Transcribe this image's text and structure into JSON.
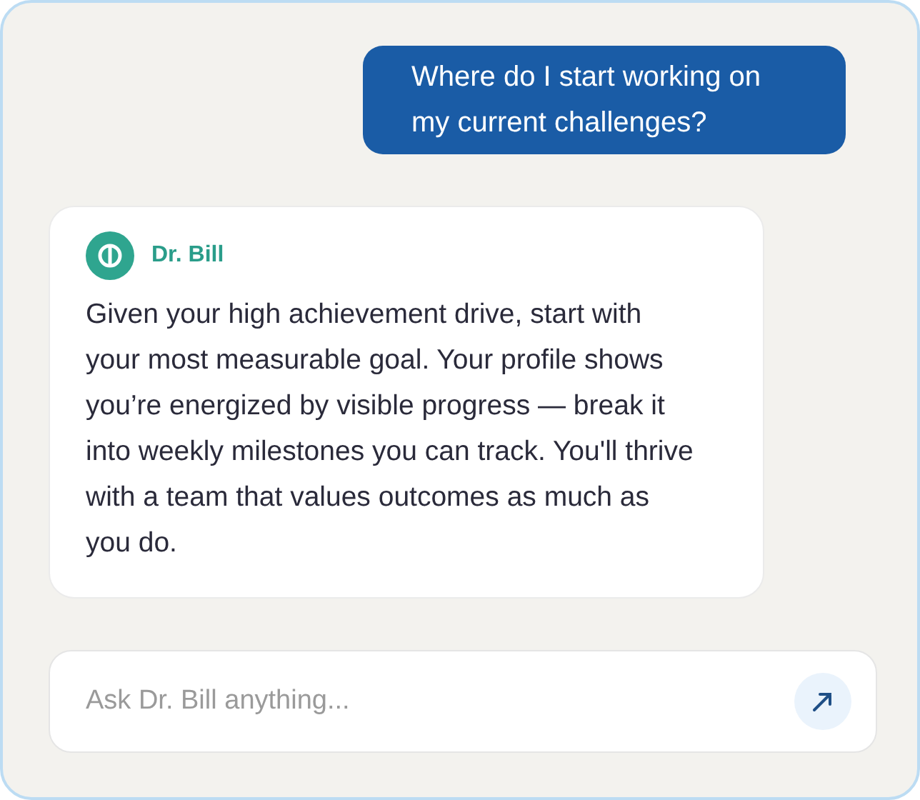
{
  "messages": [
    {
      "kind": "user",
      "text": "Where do I start working on my current challenges?"
    },
    {
      "kind": "assistant",
      "sender": "Dr. Bill",
      "text": "Given your high achievement drive, start with your most measurable goal. Your profile shows you’re energized by visible progress — break it into weekly milestones you can track. You'll thrive with a team that values outcomes as much as you do."
    }
  ],
  "input": {
    "placeholder": "Ask Dr. Bill anything..."
  }
}
